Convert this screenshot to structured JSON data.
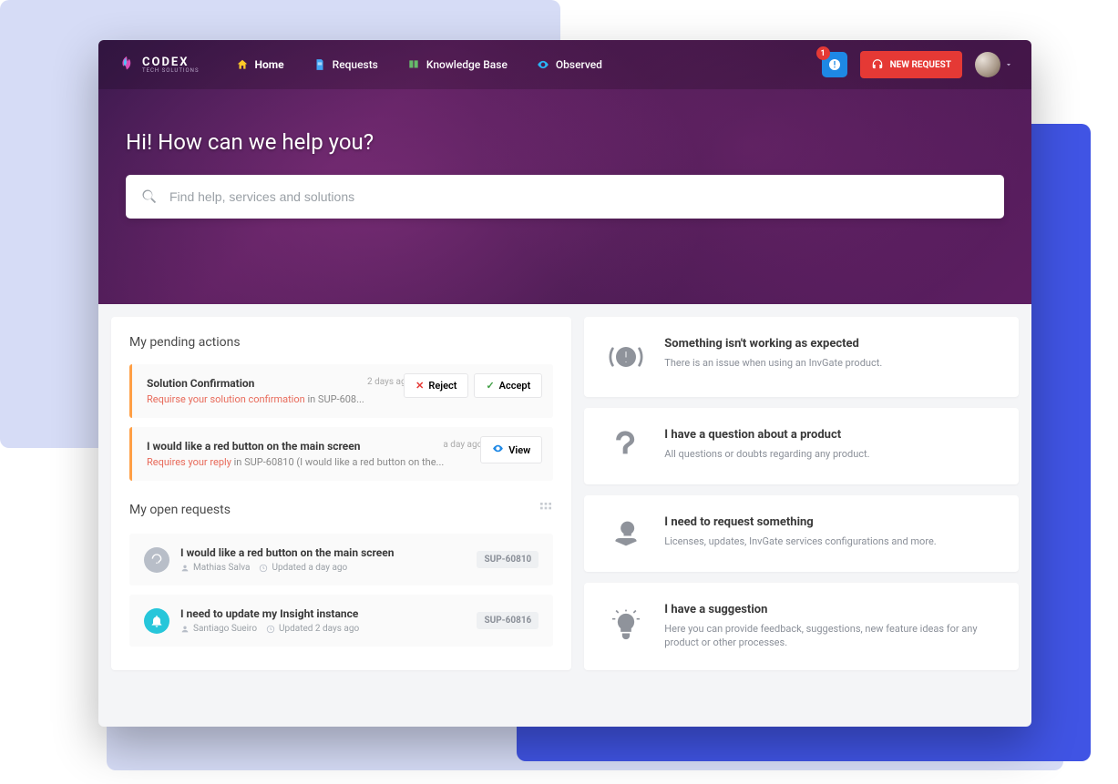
{
  "brand": {
    "name": "CODEX",
    "tagline": "TECH SOLUTIONS"
  },
  "nav": {
    "home": "Home",
    "requests": "Requests",
    "kb": "Knowledge Base",
    "observed": "Observed"
  },
  "header": {
    "notif_count": "1",
    "new_request": "NEW REQUEST"
  },
  "hero": {
    "title": "Hi! How can we help you?",
    "search_placeholder": "Find help, services and solutions"
  },
  "pending": {
    "title": "My pending actions",
    "items": [
      {
        "title": "Solution Confirmation",
        "red": "Requirse your solution confirmation",
        "tail": " in SUP-608...",
        "time": "2 days ago",
        "reject": "Reject",
        "accept": "Accept"
      },
      {
        "title": "I would like a red button on the main screen",
        "red": "Requires your reply",
        "tail": " in SUP-60810 (I would like a red button on the...",
        "time": "a day ago",
        "view": "View"
      }
    ]
  },
  "open": {
    "title": "My open requests",
    "items": [
      {
        "title": "I would like a red button on the main screen",
        "author": "Mathias Salva",
        "updated": "Updated a day ago",
        "id": "SUP-60810"
      },
      {
        "title": "I need to update my Insight instance",
        "author": "Santiago Sueiro",
        "updated": "Updated 2 days ago",
        "id": "SUP-60816"
      }
    ]
  },
  "categories": [
    {
      "title": "Something isn't working as expected",
      "desc": "There is an issue when using an InvGate product."
    },
    {
      "title": "I have a question about a product",
      "desc": "All questions or doubts regarding any product."
    },
    {
      "title": "I need to request something",
      "desc": "Licenses, updates, InvGate services configurations and more."
    },
    {
      "title": "I have a suggestion",
      "desc": "Here you can provide feedback, suggestions, new feature ideas for any product or other processes."
    }
  ]
}
